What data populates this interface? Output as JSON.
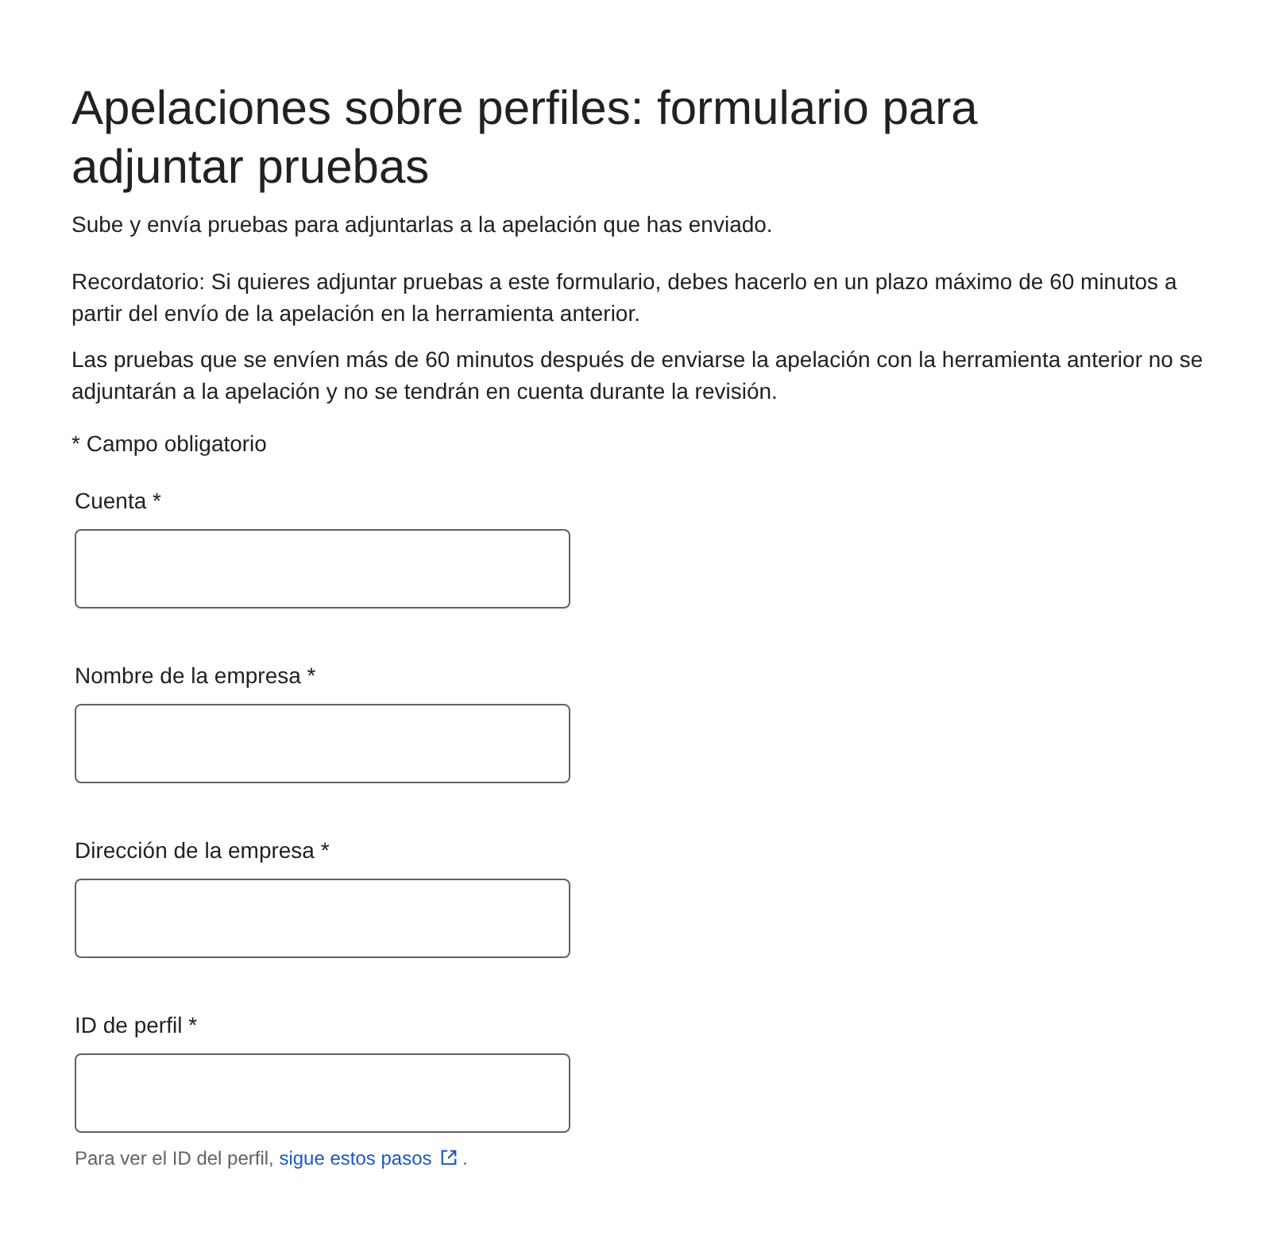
{
  "title": "Apelaciones sobre perfiles: formulario para adjuntar pruebas",
  "subtitle": "Sube y envía pruebas para adjuntarlas a la apelación que has enviado.",
  "paragraphs": [
    "Recordatorio: Si quieres adjuntar pruebas a este formulario, debes hacerlo en un plazo máximo de 60 minutos a partir del envío de la apelación en la herramienta anterior.",
    "Las pruebas que se envíen más de 60 minutos después de enviarse la apelación con la herramienta anterior no se adjuntarán a la apelación y no se tendrán en cuenta durante la revisión."
  ],
  "required_note": "* Campo obligatorio",
  "fields": [
    {
      "label": "Cuenta *"
    },
    {
      "label": "Nombre de la empresa  *"
    },
    {
      "label": "Dirección de la empresa *"
    },
    {
      "label": "ID de perfil *"
    }
  ],
  "hint": {
    "text": "Para ver el ID del perfil, ",
    "link": "sigue estos pasos",
    "end": "."
  }
}
